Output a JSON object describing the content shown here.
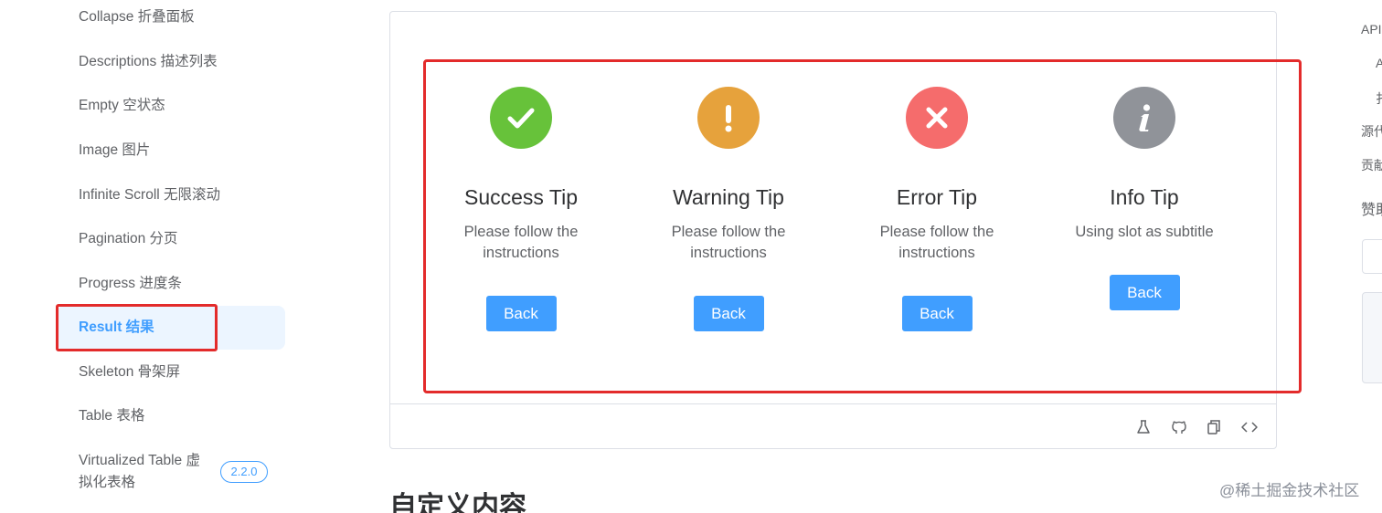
{
  "sidebar": {
    "items": [
      {
        "label": "Collapse 折叠面板"
      },
      {
        "label": "Descriptions 描述列表"
      },
      {
        "label": "Empty 空状态"
      },
      {
        "label": "Image 图片"
      },
      {
        "label": "Infinite Scroll 无限滚动"
      },
      {
        "label": "Pagination 分页"
      },
      {
        "label": "Progress 进度条"
      },
      {
        "label": "Result 结果"
      },
      {
        "label": "Skeleton 骨架屏"
      },
      {
        "label": "Table 表格"
      }
    ],
    "virtualized": {
      "line1": "Virtualized Table 虚",
      "line2": "拟化表格",
      "badge": "2.2.0"
    }
  },
  "results": [
    {
      "title": "Success Tip",
      "subtitle": "Please follow the instructions",
      "button": "Back",
      "icon": "success-icon",
      "color": "#67c23a"
    },
    {
      "title": "Warning Tip",
      "subtitle": "Please follow the instructions",
      "button": "Back",
      "icon": "warning-icon",
      "color": "#e6a23c"
    },
    {
      "title": "Error Tip",
      "subtitle": "Please follow the instructions",
      "button": "Back",
      "icon": "error-icon",
      "color": "#f56c6c"
    },
    {
      "title": "Info Tip",
      "subtitle": "Using slot as subtitle",
      "button": "Back",
      "icon": "info-icon",
      "color": "#909399"
    }
  ],
  "demo_toolbar": {
    "icons": [
      "playground-flask-icon",
      "github-icon",
      "copy-icon",
      "code-icon"
    ]
  },
  "section": {
    "title": "自定义内容"
  },
  "toc": {
    "items": [
      "API",
      "A",
      "扌",
      "源代",
      "贡献",
      "赞助"
    ]
  },
  "watermark": "@稀土掘金技术社区",
  "colors": {
    "primary": "#409eff",
    "highlight_border": "#e32b2b"
  }
}
